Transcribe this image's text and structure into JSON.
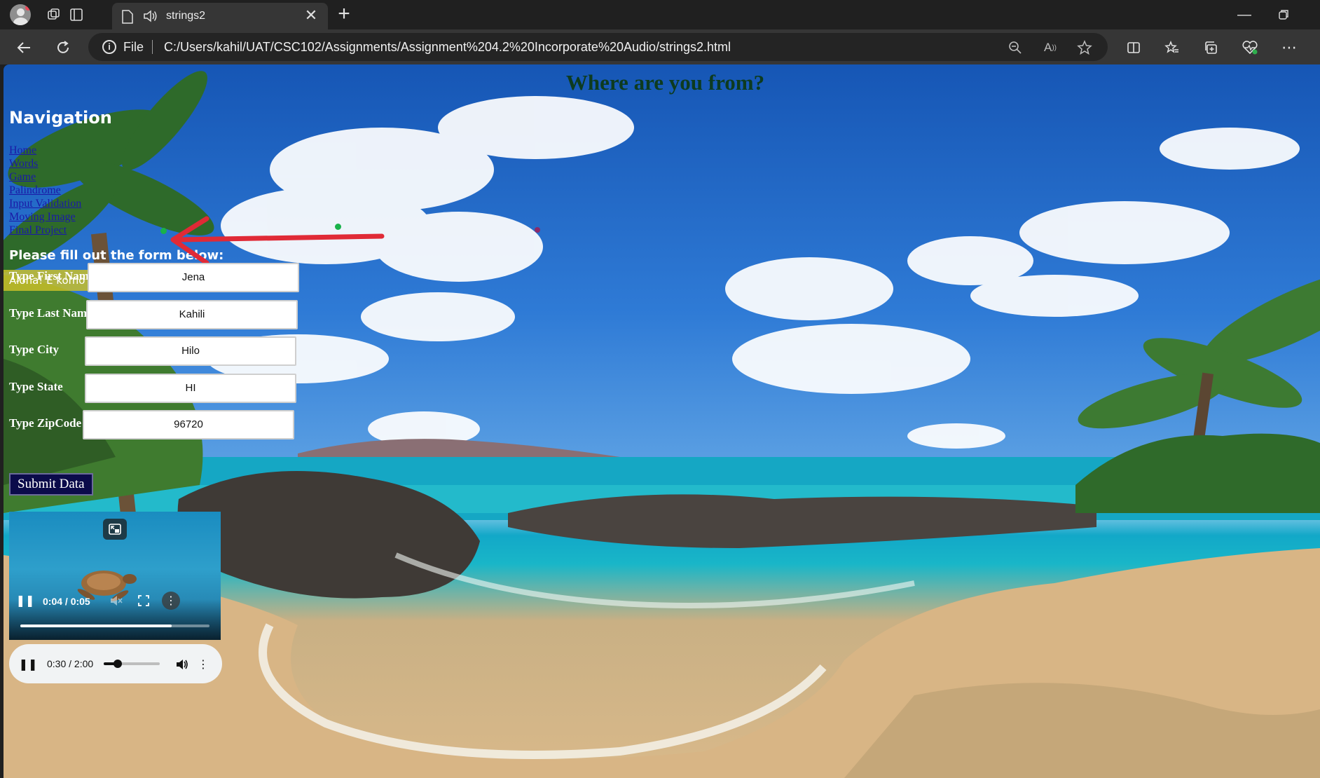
{
  "browser": {
    "tab_title": "strings2",
    "address_scheme": "File",
    "url": "C:/Users/kahil/UAT/CSC102/Assignments/Assignment%204.2%20Incorporate%20Audio/strings2.html"
  },
  "page": {
    "heading": "Where are you from?",
    "nav_title": "Navigation",
    "nav_links": [
      "Home",
      "Words",
      "Game",
      "Palindrome",
      "Input Validation",
      "Moving Image",
      "Final Project"
    ],
    "form_title": "Please fill out the form below:",
    "greeting": "Aloha! E komo Mai: Jena Kahili",
    "fields": [
      {
        "label": "Type First Name",
        "value": "Jena"
      },
      {
        "label": "Type Last Name",
        "value": "Kahili"
      },
      {
        "label": "Type City",
        "value": "Hilo"
      },
      {
        "label": "Type State",
        "value": "HI"
      },
      {
        "label": "Type ZipCode",
        "value": "96720"
      }
    ],
    "submit_label": "Submit Data",
    "video": {
      "time": "0:04 / 0:05",
      "progress": 0.8
    },
    "audio": {
      "time": "0:30 / 2:00",
      "progress": 0.25
    }
  },
  "colors": {
    "heading": "#0d3b1f",
    "link": "#1a1aa6",
    "greeting_bg": "#c8be28",
    "submit_bg": "#0b0b4a",
    "annotation_arrow": "#e02a36"
  }
}
